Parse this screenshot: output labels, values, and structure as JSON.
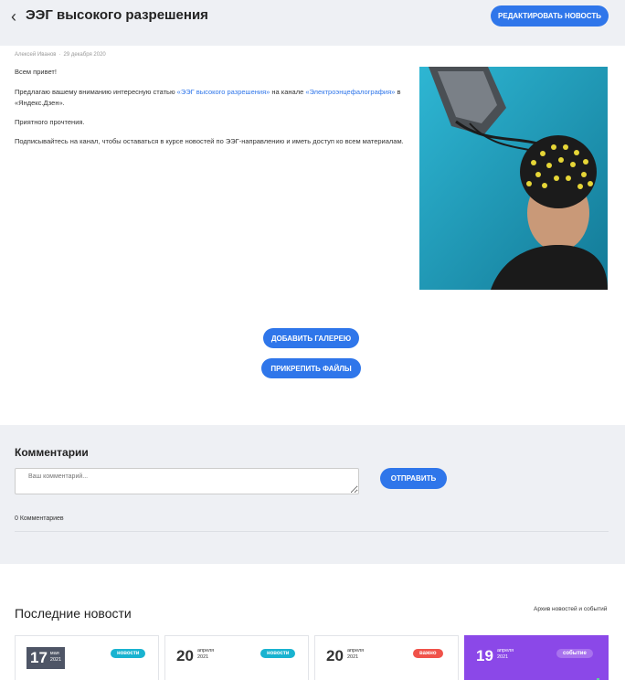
{
  "header": {
    "back_icon": "chevron-left-icon",
    "title": "ЭЭГ высокого разрешения",
    "edit_button": "РЕДАКТИРОВАТЬ НОВОСТЬ"
  },
  "article": {
    "author": "Алексей Иванов",
    "date": "29 декабря 2020",
    "greeting": "Всем привет!",
    "p1_before": "Предлагаю вашему вниманию интересную статью ",
    "p1_link1": "«ЭЭГ высокого разрешения»",
    "p1_middle": " на канале ",
    "p1_link2": "«Электроэнцефалография»",
    "p1_after": " в «Яндекс.Дзен».",
    "p2": "Приятного прочтения.",
    "p3": "Подписывайтесь на канал, чтобы оставаться в курсе новостей по ЭЭГ-направлению и иметь доступ ко всем материалам.",
    "add_gallery_button": "ДОБАВИТЬ ГАЛЕРЕЮ",
    "attach_files_button": "ПРИКРЕПИТЬ ФАЙЛЫ"
  },
  "comments": {
    "title": "Комментарии",
    "placeholder": "Ваш комментарий...",
    "send_button": "ОТПРАВИТЬ",
    "count_text": "0 Комментариев"
  },
  "news": {
    "title": "Последние новости",
    "archive_link": "Архив новостей и событий",
    "cards": [
      {
        "day": "17",
        "month": "мая",
        "year": "2021",
        "badge": "новости",
        "badge_color": "#19b3d0"
      },
      {
        "day": "20",
        "month": "апреля",
        "year": "2021",
        "badge": "новости",
        "badge_color": "#19b3d0"
      },
      {
        "day": "20",
        "month": "апреля",
        "year": "2021",
        "badge": "важно",
        "badge_color": "#f0524a"
      },
      {
        "day": "19",
        "month": "апреля",
        "year": "2021",
        "badge": "событие",
        "badge_color": "#a872ee"
      }
    ]
  },
  "colors": {
    "accent": "#2f76ea",
    "background": "#eef0f4",
    "event_card": "#8b48e8"
  }
}
